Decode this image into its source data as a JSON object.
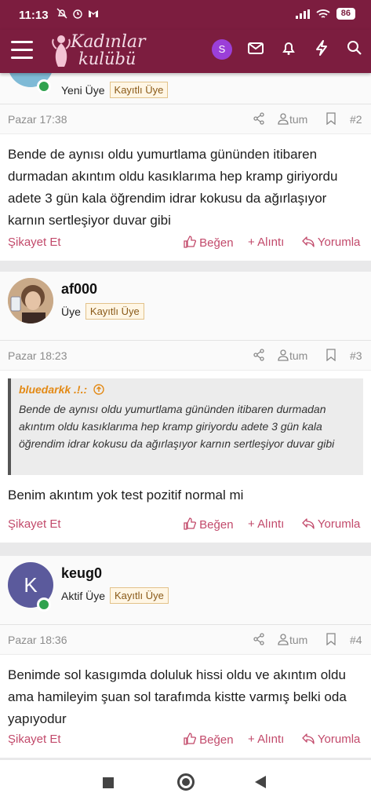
{
  "status_bar": {
    "time": "11:13",
    "battery": "86"
  },
  "app": {
    "logo_line1": "Kadınlar",
    "logo_line2": "kulübü",
    "avatar_letter": "S",
    "accent": "#7c1d3f",
    "icons": [
      "menu-icon",
      "mail-icon",
      "bell-icon",
      "lightning-icon",
      "search-icon"
    ]
  },
  "posts": [
    {
      "role": "Yeni Üye",
      "badge": "Kayıtlı Üye",
      "date": "Pazar 17:38",
      "tum": "tum",
      "number": "#2",
      "body": "Bende de aynısı oldu yumurtlama gününden itibaren durmadan akıntım oldu kasıklarıma hep kramp giriyordu adete 3 gün kala öğrendim idrar kokusu da ağırlaşıyor karnın sertleşiyor duvar gibi",
      "report": "Şikayet Et",
      "like": "Beğen",
      "quote": "Alıntı",
      "reply": "Yorumla"
    },
    {
      "username": "af000",
      "role": "Üye",
      "badge": "Kayıtlı Üye",
      "date": "Pazar 18:23",
      "tum": "tum",
      "number": "#3",
      "quote_author": "bluedarkk .!.:",
      "quote_text": "Bende de aynısı oldu yumurtlama gününden itibaren durmadan akıntım oldu kasıklarıma hep kramp giriyordu adete 3 gün kala öğrendim idrar kokusu da ağırlaşıyor karnın sertleşiyor duvar gibi",
      "body": "Benim akıntım yok test pozitif normal mi",
      "report": "Şikayet Et",
      "like": "Beğen",
      "quote": "Alıntı",
      "reply": "Yorumla"
    },
    {
      "username": "keug0",
      "avatar_letter": "K",
      "role": "Aktif Üye",
      "badge": "Kayıtlı Üye",
      "date": "Pazar 18:36",
      "tum": "tum",
      "number": "#4",
      "body": "Benimde sol kasıgımda doluluk hissi oldu ve akıntım oldu ama hamileyim şuan sol tarafımda kistte varmış belki oda yapıyodur",
      "report": "Şikayet Et",
      "like": "Beğen",
      "quote": "Alıntı",
      "reply": "Yorumla"
    }
  ]
}
